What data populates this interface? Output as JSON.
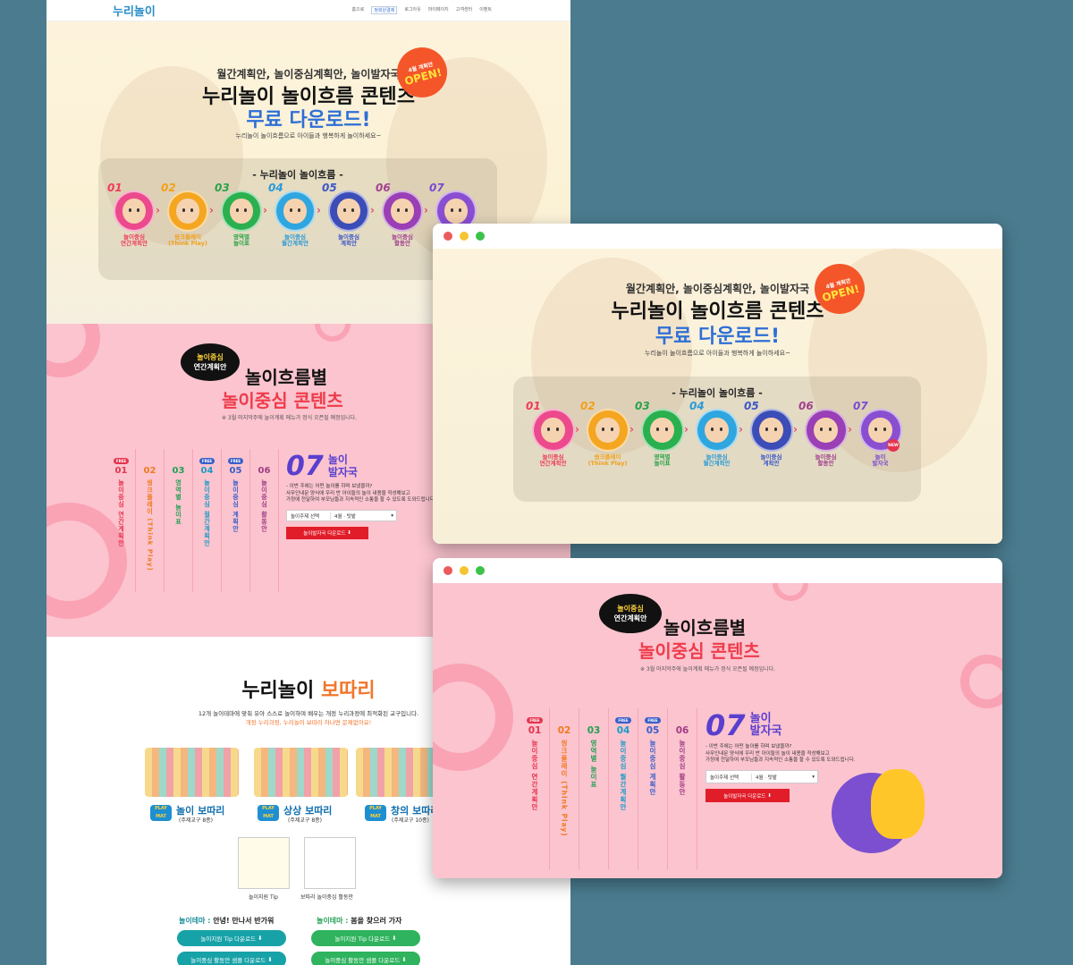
{
  "nav": {
    "logo": "누리놀이",
    "links": [
      "홈으로",
      "정회원결제",
      "로그아웃",
      "마이페이지",
      "고객센터",
      "이벤트"
    ]
  },
  "hero": {
    "subtitle": "월간계획안, 놀이중심계획안, 놀이발자국",
    "title": "누리놀이 놀이흐름 콘텐츠",
    "highlight": "무료 다운로드!",
    "desc": "누리놀이 놀이흐름으로 아이들과 행복하게 놀이하세요~",
    "badge_top": "4월 계획안",
    "badge_bottom": "OPEN!",
    "flow_title": "- 누리놀이 놀이흐름 -",
    "steps": [
      {
        "num": "01",
        "label1": "놀이중심",
        "label2": "연간계획안",
        "color": "#ec4a8c",
        "numcolor": "#ef3b5a"
      },
      {
        "num": "02",
        "label1": "씽크플레이",
        "label2": "(Think Play)",
        "color": "#f4a620",
        "numcolor": "#f2a019"
      },
      {
        "num": "03",
        "label1": "영역별",
        "label2": "놀이표",
        "color": "#2ab04e",
        "numcolor": "#29a34a"
      },
      {
        "num": "04",
        "label1": "놀이중심",
        "label2": "월간계획안",
        "color": "#2fa6df",
        "numcolor": "#2a9ad8"
      },
      {
        "num": "05",
        "label1": "놀이중심",
        "label2": "계획안",
        "color": "#3c4db8",
        "numcolor": "#3c58c9"
      },
      {
        "num": "06",
        "label1": "놀이중심",
        "label2": "활동안",
        "color": "#9a3fb5",
        "numcolor": "#a2418f"
      },
      {
        "num": "07",
        "label1": "놀이",
        "label2": "발자국",
        "color": "#8a4fd1",
        "numcolor": "#7a4bd2"
      }
    ],
    "new_badge": "NEW"
  },
  "content": {
    "bubble1": "놀이중심",
    "bubble2": "연간계획안",
    "title1": "놀이흐름별",
    "title2": "놀이중심 콘텐츠",
    "note": "※ 3월 마지막주에 놀이계획 메뉴가 정식 오픈될 예정입니다.",
    "free": "FREE",
    "tabs": [
      {
        "num": "01",
        "text": "놀이중심 연간계획안",
        "color": "#e6344d",
        "free": "red"
      },
      {
        "num": "02",
        "text": "씽크플레이 (Think Play)",
        "color": "#f07a1e",
        "free": ""
      },
      {
        "num": "03",
        "text": "영역별 놀이표",
        "color": "#23a055",
        "free": ""
      },
      {
        "num": "04",
        "text": "놀이중심 월간계획안",
        "color": "#1b9ac8",
        "free": "blue"
      },
      {
        "num": "05",
        "text": "놀이중심 계획안",
        "color": "#3a5ec9",
        "free": "blue"
      },
      {
        "num": "06",
        "text": "놀이중심 활동안",
        "color": "#a13d86",
        "free": ""
      }
    ],
    "sel_num": "07",
    "sel_t1": "놀이",
    "sel_t2": "발자국",
    "sel_q": "- 이번 주에는 어떤 놀이를 하며 보냈을까?",
    "sel_d1": "사무인내문 양식에 우리 반 아이들의 놀이 내용을 작성해보고",
    "sel_d2": "가정에 전달하여 부모님들과 지속적인 소통을 할 수 있도록 도와드립니다.",
    "dd_label": "놀이주제 선택",
    "dd_value": "4월 · 텃밭",
    "dl_label": "놀이발자국 다운로드"
  },
  "bottari": {
    "title_a": "누리놀이 ",
    "title_b": "보따리",
    "desc": "12개 놀이테마에 맞춰 유아 스스로 놀이하며 배우는 개정 누리과정에 최적화된 교구입니다.",
    "desc2": "개정 누리과정, 누리놀이 보따리 하나면 문제없어요!",
    "kits": [
      {
        "name": "놀이 보따리",
        "sub": "(주제교구 8종)"
      },
      {
        "name": "상상 보따리",
        "sub": "(주제교구 8종)"
      },
      {
        "name": "창의 보따리",
        "sub": "(주제교구 10종)"
      }
    ],
    "playmat": "PLAY MAT",
    "docs": [
      "놀이지원 Tip",
      "보따리 놀이중심 활동안"
    ],
    "theme_label": "놀이테마 :",
    "theme1": "안녕! 만나서 반가워",
    "theme2": "봄을 찾으러 가자",
    "btn_tip": "놀이지원 Tip 다운로드",
    "btn_sample": "놀이중심 활동안 샘플 다운로드"
  },
  "window_dots": [
    "#ec5b5b",
    "#f3c531",
    "#3cc24a"
  ]
}
